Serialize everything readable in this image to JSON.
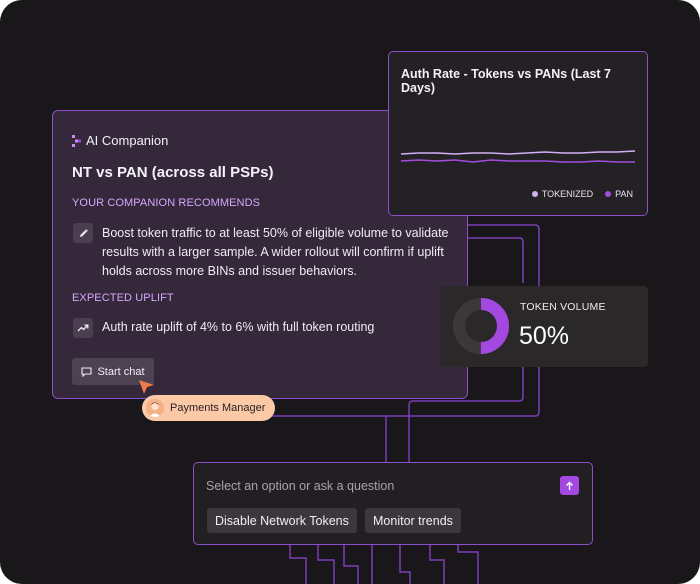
{
  "companion": {
    "brand": "AI Companion",
    "title": "NT vs PAN (across all PSPs)",
    "recommends_label": "YOUR COMPANION RECOMMENDS",
    "recommendation": "Boost token traffic to at least 50% of eligible volume to validate results with a larger sample. A wider rollout will confirm if uplift holds across more BINs and issuer behaviors.",
    "uplift_label": "EXPECTED UPLIFT",
    "uplift": "Auth rate uplift of 4% to 6% with full token routing",
    "start_chat": "Start chat"
  },
  "user_pill": {
    "name": "Payments Manager"
  },
  "chart_data": {
    "type": "line",
    "title": "Auth Rate - Tokens vs PANs (Last 7 Days)",
    "x": [
      1,
      2,
      3,
      4,
      5,
      6,
      7,
      8,
      9,
      10,
      11,
      12,
      13,
      14
    ],
    "series": [
      {
        "name": "TOKENIZED",
        "color": "#d2b0f4",
        "values": [
          50.0,
          50.1,
          50.1,
          50.0,
          50.1,
          50.1,
          50.0,
          50.1,
          50.2,
          50.1,
          50.1,
          50.2,
          50.2,
          50.3
        ]
      },
      {
        "name": "PAN",
        "color": "#a24de0",
        "values": [
          49.3,
          49.4,
          49.3,
          49.4,
          49.2,
          49.4,
          49.3,
          49.3,
          49.3,
          49.2,
          49.2,
          49.3,
          49.2,
          49.2
        ]
      }
    ],
    "ylim": [
      47,
      51
    ],
    "grid": false,
    "legend": "bottom-right"
  },
  "token": {
    "label": "TOKEN VOLUME",
    "value": "50%",
    "fraction": 0.5,
    "color": "#a348e0"
  },
  "ask": {
    "placeholder": "Select an option or ask a question",
    "chips": [
      "Disable Network Tokens",
      "Monitor trends"
    ]
  },
  "colors": {
    "accent": "#a348e0",
    "border": "#8b4fc9",
    "label": "#d6a8ff",
    "pill": "#fbc9a6"
  },
  "icons": [
    "companion-logo-icon",
    "pencil-icon",
    "trend-up-icon",
    "chat-bubble-icon",
    "pointer-cursor-icon",
    "arrow-up-icon"
  ]
}
